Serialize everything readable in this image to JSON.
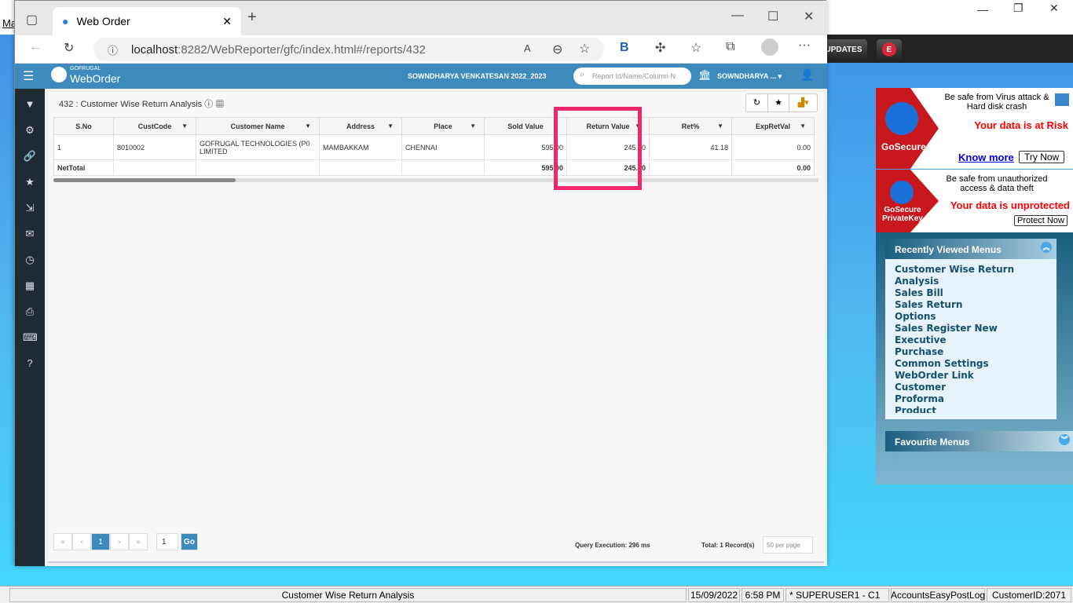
{
  "browser": {
    "tab_title": "Web Order",
    "url_host": "localhost",
    "url_rest": ":8282/WebReporter/gfc/index.html#/reports/432"
  },
  "app": {
    "brand_small": "GOFRUGAL",
    "brand": "WebOrder",
    "user_period": "SOWNDHARYA VENKATESAN 2022_2023",
    "search_placeholder": "Report Id/Name/Column N",
    "company": "SOWNDHARYA ..."
  },
  "report": {
    "title": "432 : Customer Wise Return Analysis",
    "columns": [
      "S.No",
      "CustCode",
      "Customer Name",
      "Address",
      "Place",
      "Sold Value",
      "Return Value",
      "Ret%",
      "ExpRetVal"
    ],
    "rows": [
      [
        "1",
        "8010002",
        "GOFRUGAL TECHNOLOGIES (P0 LIMITED",
        "MAMBAKKAM",
        "CHENNAI",
        "595.00",
        "245.00",
        "41.18",
        "0.00"
      ]
    ],
    "total": {
      "label": "NetTotal",
      "sold": "595.00",
      "return": "245.00",
      "exp": "0.00"
    }
  },
  "pagination": {
    "first": "«",
    "prev": "‹",
    "current": "1",
    "next": "›",
    "last": "»",
    "goto_value": "1",
    "go": "Go",
    "query_time": "Query Execution: 296 ms",
    "total": "Total: 1 Record(s)",
    "per_page": "50 per page"
  },
  "desktop": {
    "left_label": "Ma",
    "updates": "UPDATES",
    "e_badge": "E"
  },
  "ads": {
    "a1_brand": "GoSecure",
    "a1_line1": "Be safe from Virus attack &",
    "a1_line2": "Hard disk crash",
    "a1_alert": "Your data is at Risk",
    "a1_link": "Know more",
    "a1_btn": "Try Now",
    "a2_brand1": "GoSecure",
    "a2_brand2": "PrivateKey",
    "a2_line1": "Be safe from unauthorized",
    "a2_line2": "access & data theft",
    "a2_alert": "Your data is unprotected",
    "a2_btn": "Protect Now"
  },
  "recent": {
    "title": "Recently Viewed Menus",
    "items": [
      "Customer Wise Return Analysis",
      "Sales Bill",
      "Sales Return",
      "Options",
      "Sales Register New",
      "Executive",
      "Purchase",
      "Common Settings",
      "WebOrder Link",
      "Customer",
      "Proforma",
      "Product"
    ]
  },
  "favourite": {
    "title": "Favourite Menus"
  },
  "status": {
    "module": "Customer Wise Return Analysis",
    "date": "15/09/2022",
    "time": "6:58 PM",
    "user": "* SUPERUSER1 - C1",
    "log": "AccountsEasyPostLog",
    "customer": "CustomerID:2071"
  },
  "colors": {
    "header": "#3d8bbd",
    "highlight": "#f0286a",
    "sidebar": "#1f2a33"
  }
}
